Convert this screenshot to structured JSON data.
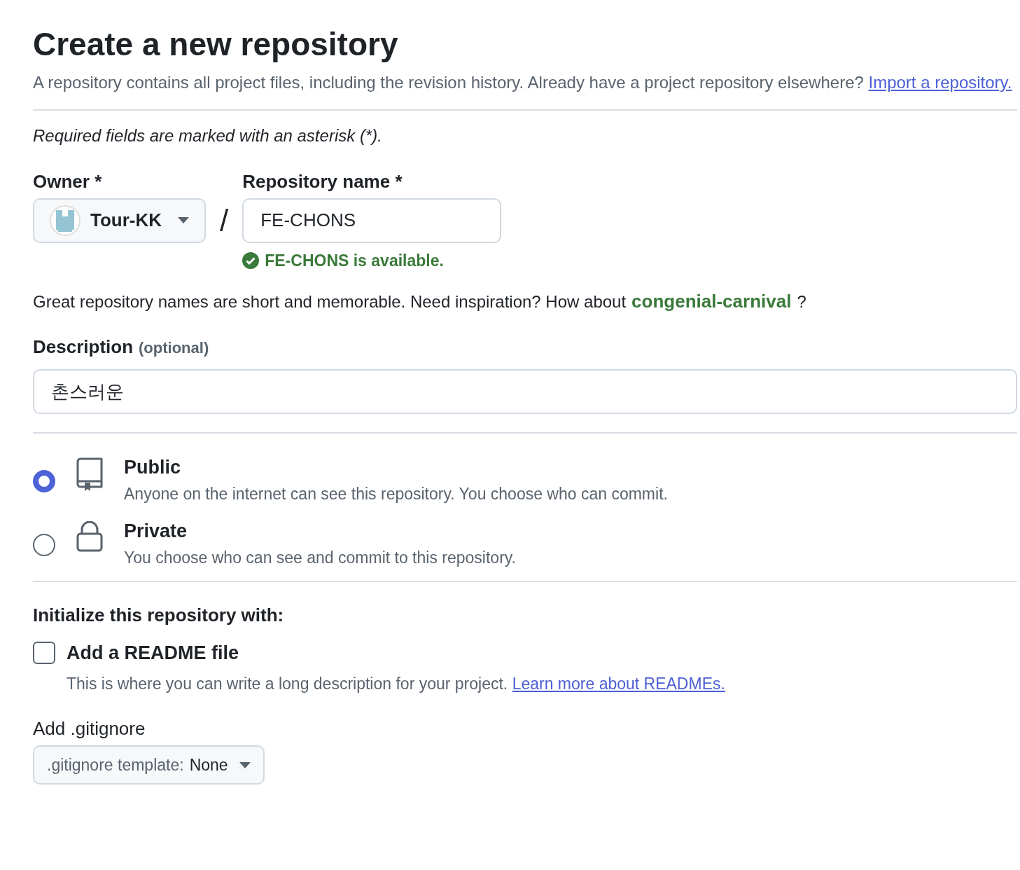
{
  "title": "Create a new repository",
  "intro": "A repository contains all project files, including the revision history. Already have a project repository elsewhere?",
  "import_link": "Import a repository.",
  "required_note": "Required fields are marked with an asterisk (*).",
  "owner": {
    "label": "Owner *",
    "value": "Tour-KK"
  },
  "separator": "/",
  "repo_name": {
    "label": "Repository name *",
    "value": "FE-CHONS",
    "status": "FE-CHONS is available."
  },
  "suggestion": {
    "text": "Great repository names are short and memorable. Need inspiration? How about",
    "name": "congenial-carnival",
    "trailing": "?"
  },
  "description": {
    "label": "Description",
    "hint": "(optional)",
    "value": "촌스러운"
  },
  "visibility": [
    {
      "kind": "public",
      "title": "Public",
      "text": "Anyone on the internet can see this repository. You choose who can commit.",
      "selected": true
    },
    {
      "kind": "private",
      "title": "Private",
      "text": "You choose who can see and commit to this repository.",
      "selected": false
    }
  ],
  "initialize": {
    "heading": "Initialize this repository with:",
    "readme": {
      "label": "Add a README file",
      "checked": false,
      "text": "This is where you can write a long description for your project.",
      "link": "Learn more about READMEs."
    }
  },
  "gitignore": {
    "label": "Add .gitignore",
    "prefix": ".gitignore template:",
    "value": "None"
  }
}
